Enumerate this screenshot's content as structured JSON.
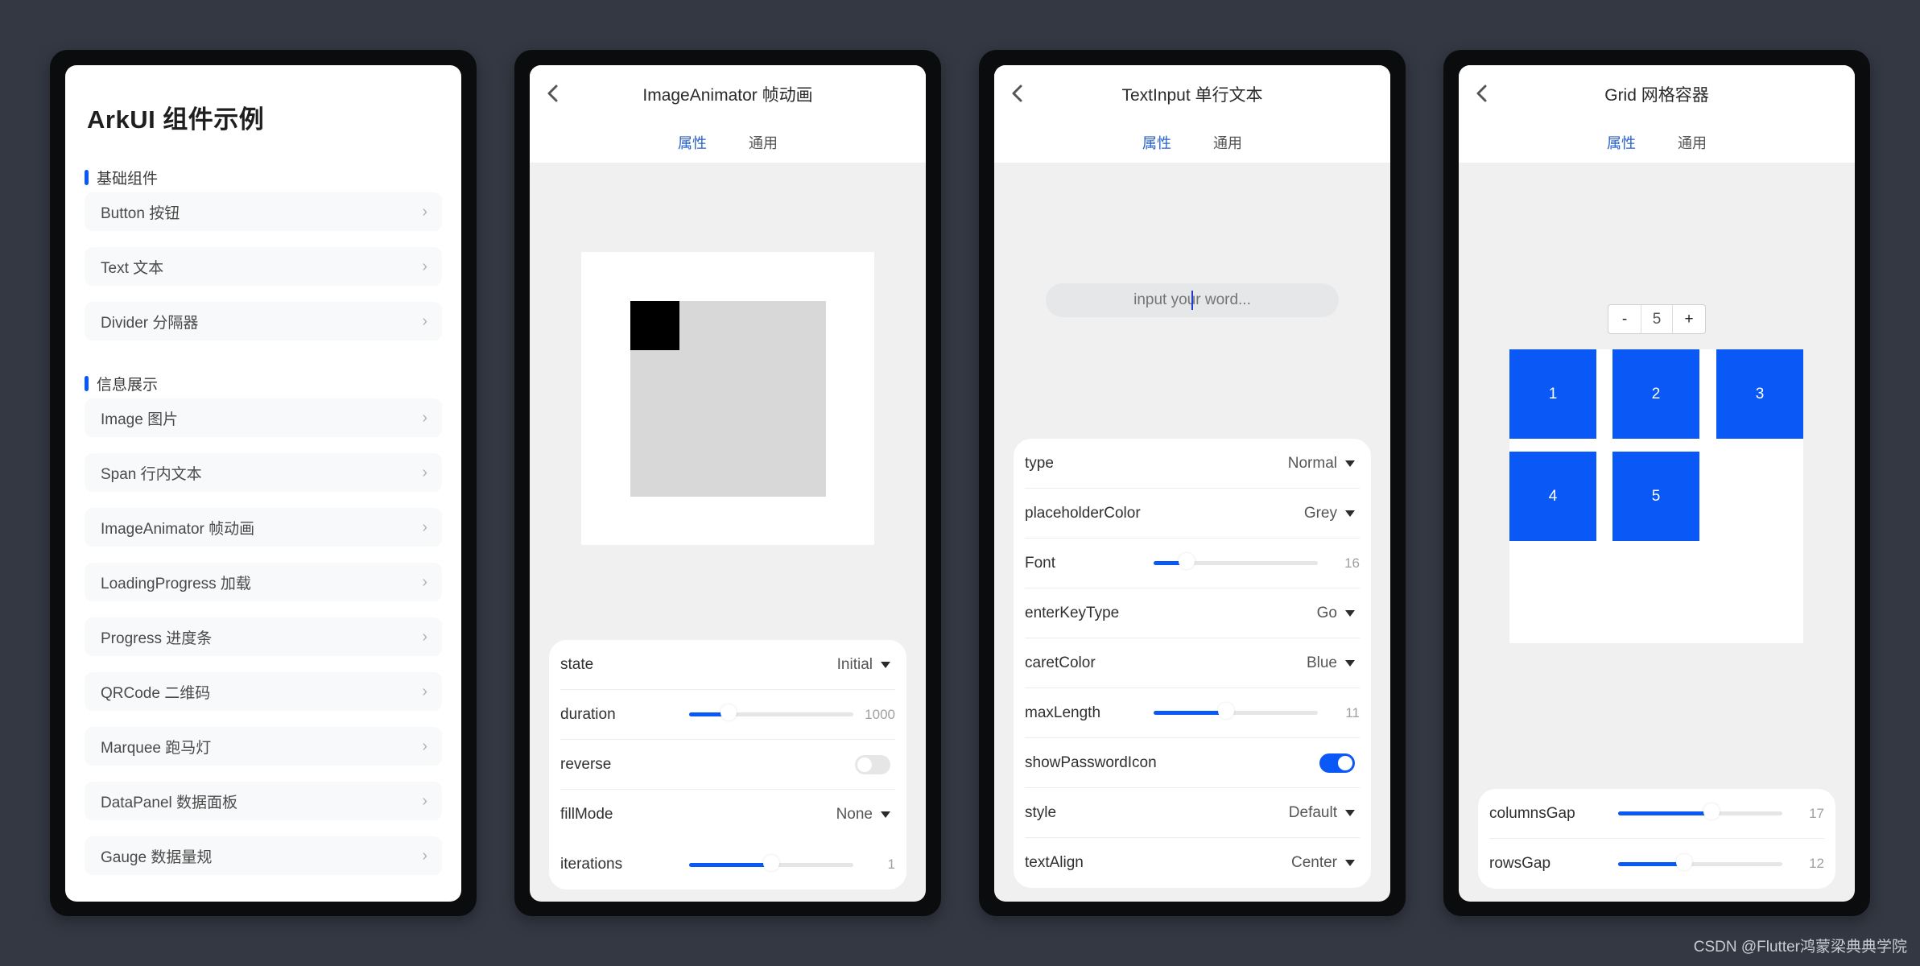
{
  "panels": {
    "home": {
      "title": "ArkUI 组件示例",
      "sections": [
        {
          "label": "基础组件",
          "items": [
            "Button 按钮",
            "Text 文本",
            "Divider 分隔器"
          ]
        },
        {
          "label": "信息展示",
          "items": [
            "Image 图片",
            "Span 行内文本",
            "ImageAnimator 帧动画",
            "LoadingProgress 加载",
            "Progress 进度条",
            "QRCode 二维码",
            "Marquee 跑马灯",
            "DataPanel 数据面板",
            "Gauge 数据量规"
          ]
        }
      ],
      "chevron": "›"
    },
    "animator": {
      "title": "ImageAnimator 帧动画",
      "tabs": [
        "属性",
        "通用"
      ],
      "props": {
        "state": {
          "label": "state",
          "value": "Initial"
        },
        "duration": {
          "label": "duration",
          "value": "1000",
          "fraction": 0.24
        },
        "reverse": {
          "label": "reverse",
          "on": false
        },
        "fillMode": {
          "label": "fillMode",
          "value": "None"
        },
        "iterations": {
          "label": "iterations",
          "value": "1",
          "fraction": 0.5
        }
      }
    },
    "textinput": {
      "title": "TextInput 单行文本",
      "tabs": [
        "属性",
        "通用"
      ],
      "input": {
        "placeholder": "input your word..."
      },
      "props": {
        "type": {
          "label": "type",
          "value": "Normal"
        },
        "placeholderColor": {
          "label": "placeholderColor",
          "value": "Grey"
        },
        "font": {
          "label": "Font",
          "value": "16",
          "fraction": 0.2
        },
        "enterKeyType": {
          "label": "enterKeyType",
          "value": "Go"
        },
        "caretColor": {
          "label": "caretColor",
          "value": "Blue"
        },
        "maxLength": {
          "label": "maxLength",
          "value": "11",
          "fraction": 0.44
        },
        "showPasswordIcon": {
          "label": "showPasswordIcon",
          "on": true
        },
        "style": {
          "label": "style",
          "value": "Default"
        },
        "textAlign": {
          "label": "textAlign",
          "value": "Center"
        }
      }
    },
    "grid": {
      "title": "Grid 网格容器",
      "tabs": [
        "属性",
        "通用"
      ],
      "stepper": {
        "minus": "-",
        "value": "5",
        "plus": "+"
      },
      "cells": [
        "1",
        "2",
        "3",
        "4",
        "5"
      ],
      "props": {
        "columnsGap": {
          "label": "columnsGap",
          "value": "17",
          "fraction": 0.57
        },
        "rowsGap": {
          "label": "rowsGap",
          "value": "12",
          "fraction": 0.4
        }
      }
    }
  },
  "colors": {
    "accent": "#0a59f7",
    "tab_active": "#2a62c9",
    "background": "#343843"
  },
  "watermark": "CSDN @Flutter鸿蒙梁典典学院"
}
